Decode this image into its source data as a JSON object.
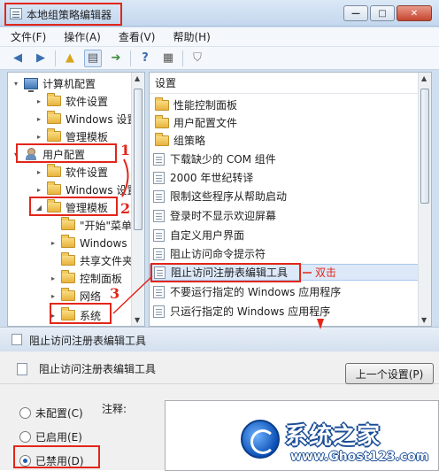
{
  "window": {
    "title": "本地组策略编辑器"
  },
  "menu": [
    "文件(F)",
    "操作(A)",
    "查看(V)",
    "帮助(H)"
  ],
  "tree": [
    {
      "label": "计算机配置",
      "icon": "computer-icon",
      "expander": "▾"
    },
    {
      "label": "软件设置",
      "icon": "folder-icon",
      "expander": "▸"
    },
    {
      "label": "Windows 设置",
      "icon": "folder-icon",
      "expander": "▸"
    },
    {
      "label": "管理模板",
      "icon": "folder-icon",
      "expander": "▸"
    },
    {
      "label": "用户配置",
      "icon": "user-icon",
      "expander": "▾"
    },
    {
      "label": "软件设置",
      "icon": "folder-icon",
      "expander": "▸"
    },
    {
      "label": "Windows 设置",
      "icon": "folder-icon",
      "expander": "▸"
    },
    {
      "label": "管理模板",
      "icon": "folder-icon",
      "expander": "◢"
    },
    {
      "label": "\"开始\"菜单",
      "icon": "folder-icon",
      "expander": ""
    },
    {
      "label": "Windows 组件",
      "icon": "folder-icon",
      "expander": "▸"
    },
    {
      "label": "共享文件夹",
      "icon": "folder-icon",
      "expander": ""
    },
    {
      "label": "控制面板",
      "icon": "folder-icon",
      "expander": "▸"
    },
    {
      "label": "网络",
      "icon": "folder-icon",
      "expander": "▸"
    },
    {
      "label": "系统",
      "icon": "folder-icon",
      "expander": "▸"
    }
  ],
  "list": {
    "header": "设置",
    "items": [
      {
        "label": "性能控制面板",
        "icon": "folder-icon"
      },
      {
        "label": "用户配置文件",
        "icon": "folder-icon"
      },
      {
        "label": "组策略",
        "icon": "folder-icon"
      },
      {
        "label": "下载缺少的 COM 组件",
        "icon": "policy-icon"
      },
      {
        "label": "2000 年世纪转译",
        "icon": "policy-icon"
      },
      {
        "label": "限制这些程序从帮助启动",
        "icon": "policy-icon"
      },
      {
        "label": "登录时不显示欢迎屏幕",
        "icon": "policy-icon"
      },
      {
        "label": "自定义用户界面",
        "icon": "policy-icon"
      },
      {
        "label": "阻止访问命令提示符",
        "icon": "policy-icon"
      },
      {
        "label": "阻止访问注册表编辑工具",
        "icon": "policy-icon",
        "selected": true
      },
      {
        "label": "不要运行指定的 Windows 应用程序",
        "icon": "policy-icon"
      },
      {
        "label": "只运行指定的 Windows 应用程序",
        "icon": "policy-icon"
      }
    ]
  },
  "dialog": {
    "title": "阻止访问注册表编辑工具",
    "setting_name": "阻止访问注册表编辑工具",
    "prev_button": "上一个设置(P)",
    "comment_label": "注释:",
    "options": [
      {
        "label": "未配置(C)",
        "checked": false
      },
      {
        "label": "已启用(E)",
        "checked": false
      },
      {
        "label": "已禁用(D)",
        "checked": true
      }
    ]
  },
  "annotations": {
    "double_click": "双击",
    "step1": "1",
    "step2": "2",
    "step3": "3"
  },
  "watermark": {
    "title": "系统之家",
    "url": "www.Ghost123.com"
  },
  "colors": {
    "annotation_red": "#e2261a",
    "selection": "#dde9f9",
    "watermark_blue": "#1a4c96"
  }
}
